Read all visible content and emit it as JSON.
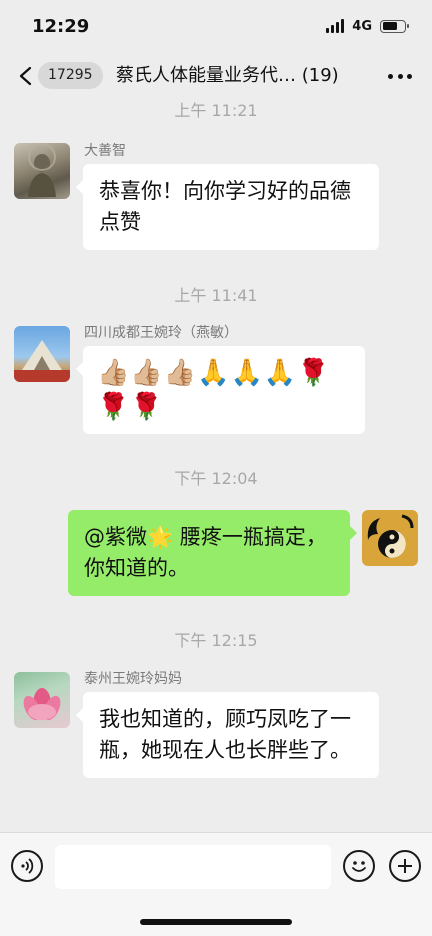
{
  "status_bar": {
    "time": "12:29",
    "network": "4G",
    "battery_level": 0.7
  },
  "nav": {
    "unread_count": "17295",
    "title": "蔡氏人体能量业务代… (19)"
  },
  "messages": [
    {
      "timestamp": "上午 11:21",
      "sender": "大善智",
      "side": "left",
      "text": "恭喜你！向你学习好的品德点赞"
    },
    {
      "timestamp": "上午 11:41",
      "sender": "四川成都王婉玲（燕敏）",
      "side": "left",
      "text": "👍🏼👍🏼👍🏼🙏🙏🙏🌹🌹🌹"
    },
    {
      "timestamp": "下午 12:04",
      "sender": "",
      "side": "right",
      "text": "@紫微🌟 腰疼一瓶搞定，你知道的。"
    },
    {
      "timestamp": "下午 12:15",
      "sender": "泰州王婉玲妈妈",
      "side": "left",
      "text": "我也知道的，顾巧凤吃了一瓶，她现在人也长胖些了。"
    }
  ],
  "colors": {
    "background": "#ededed",
    "outgoing_bubble": "#95ec69",
    "incoming_bubble": "#ffffff"
  },
  "icons": {
    "back": "chevron-left-icon",
    "more": "more-dots-icon",
    "voice": "voice-icon",
    "emoji": "emoji-icon",
    "add": "plus-icon"
  }
}
